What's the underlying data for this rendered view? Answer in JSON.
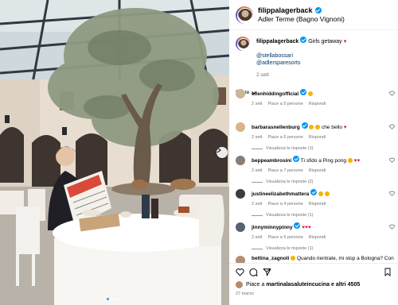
{
  "post": {
    "username": "filippalagerback",
    "location": "Adler Terme (Bagno Vignoni)"
  },
  "caption": {
    "username": "filippalagerback",
    "text": "Girls getaway",
    "tags": [
      "@stellabossari",
      "@adlersparesorts"
    ],
    "time": "2 sett"
  },
  "comments_section_label": "Per te",
  "comments": [
    {
      "username": "ellenhiddingofficial",
      "text": "",
      "emoji": "heart-eyes",
      "time": "2 sett",
      "likes": "Piace a 5 persone",
      "reply": "Rispondi",
      "replies": ""
    },
    {
      "username": "barbarasnellenburg",
      "text": "che bello",
      "emoji": "heart-eyes heart-eyes heart",
      "time": "2 sett",
      "likes": "Piace a 6 persone",
      "reply": "Rispondi",
      "replies": "Visualizza le risposte (1)"
    },
    {
      "username": "beppeambrosini",
      "text": "Ti sfido a Ping pong",
      "emoji": "smile heart heart",
      "time": "2 sett",
      "likes": "Piace a 7 persone",
      "reply": "Rispondi",
      "replies": "Visualizza le risposte (2)"
    },
    {
      "username": "justineelizabethmattera",
      "text": "",
      "emoji": "heart-eyes heart-eyes",
      "time": "2 sett",
      "likes": "Piace a 4 persone",
      "reply": "Rispondi",
      "replies": "Visualizza le risposte (1)"
    },
    {
      "username": "jinnyminnypinny",
      "text": "",
      "emoji": "heart heart heart",
      "time": "2 sett",
      "likes": "Piace a 5 persone",
      "reply": "Rispondi",
      "replies": "Visualizza le risposte (1)"
    },
    {
      "username": "bettina_zagnoli",
      "text": "Quando rientrate, mi stop a Bologna? Con",
      "emoji": "",
      "time": "",
      "likes": "",
      "reply": "",
      "replies": ""
    }
  ],
  "actions": {
    "liked_by_prefix": "Piace a",
    "liked_by_user": "martinalasaluteincucina",
    "liked_by_suffix": "e altri 4505",
    "date": "27 marzo"
  },
  "carousel": {
    "dots_total": 6,
    "active_index": 2
  },
  "colors": {
    "accent": "#0095f6",
    "heart": "#e0245e",
    "link": "#00376b"
  }
}
